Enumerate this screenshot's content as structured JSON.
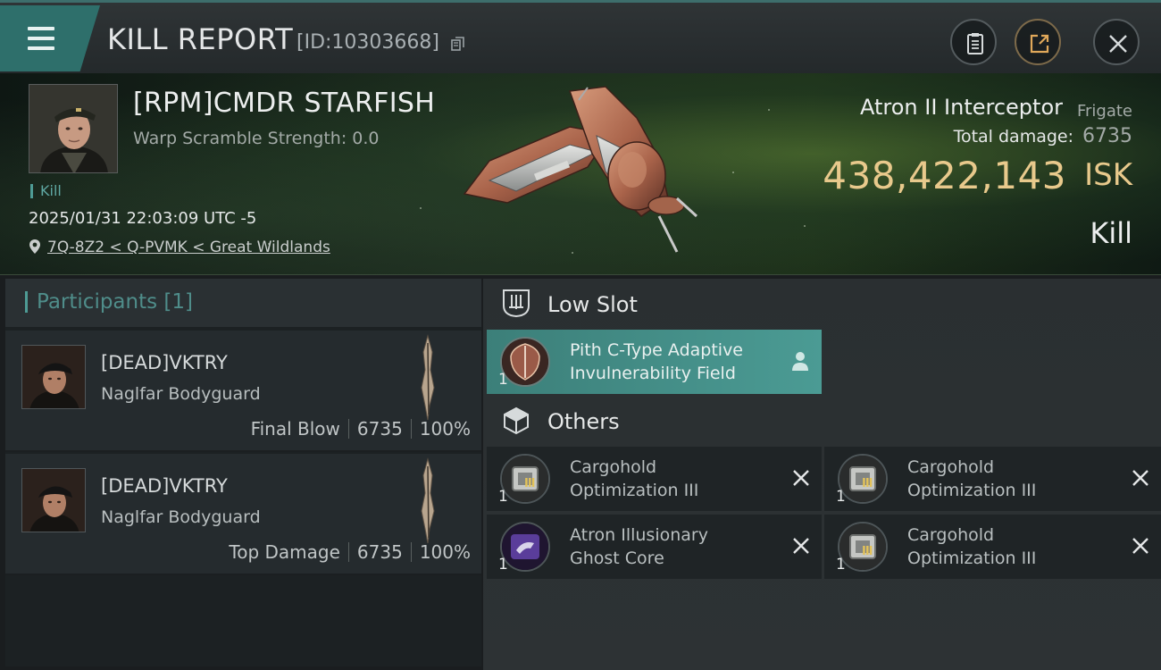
{
  "header": {
    "title": "KILL REPORT",
    "report_id": "[ID:10303668]"
  },
  "victim": {
    "name": "[RPM]CMDR STARFISH",
    "warp_scramble": "Warp Scramble Strength: 0.0",
    "tag": "Kill",
    "datetime": "2025/01/31 22:03:09 UTC -5",
    "location": "7Q-8Z2 < Q-PVMK < Great Wildlands"
  },
  "ship": {
    "name": "Atron II Interceptor",
    "class": "Frigate",
    "damage_label": "Total damage:",
    "damage_value": "6735",
    "isk_value": "438,422,143",
    "isk_unit": "ISK",
    "kill_type": "Kill"
  },
  "participants": {
    "title": "Participants [1]",
    "rows": [
      {
        "name": "[DEAD]VKTRY",
        "corp": "Naglfar Bodyguard",
        "role": "Final Blow",
        "damage": "6735",
        "percent": "100%"
      },
      {
        "name": "[DEAD]VKTRY",
        "corp": "Naglfar Bodyguard",
        "role": "Top Damage",
        "damage": "6735",
        "percent": "100%"
      }
    ]
  },
  "sections": {
    "low_slot": {
      "label": "Low Slot",
      "items": [
        {
          "qty": "1",
          "line1": "Pith C-Type Adaptive",
          "line2": "Invulnerability Field"
        }
      ]
    },
    "others": {
      "label": "Others",
      "items": [
        {
          "qty": "1",
          "line1": "Cargohold",
          "line2": "Optimization III"
        },
        {
          "qty": "1",
          "line1": "Cargohold",
          "line2": "Optimization III"
        },
        {
          "qty": "1",
          "line1": "Atron Illusionary",
          "line2": "Ghost Core"
        },
        {
          "qty": "1",
          "line1": "Cargohold",
          "line2": "Optimization III"
        }
      ]
    }
  },
  "colors": {
    "accent_teal": "#4e9b95",
    "isk_gold": "#e8c98c",
    "low_slot_bg": "#4b9b94"
  }
}
